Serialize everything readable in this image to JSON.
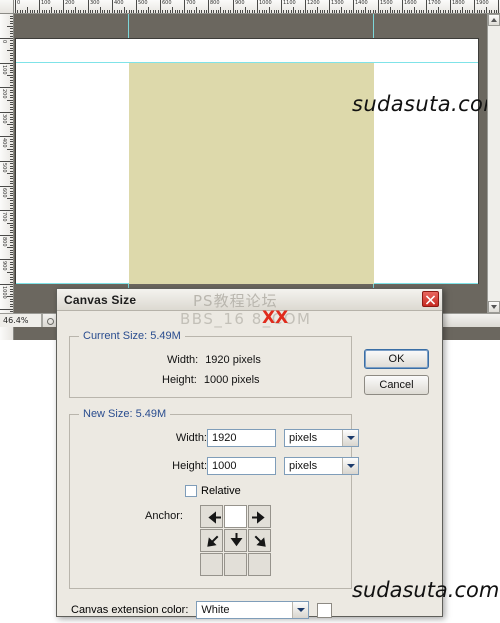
{
  "app": {
    "document_window": {
      "zoom_level": "46.4%",
      "status_text": "",
      "ruler_unit_labels_h": [
        "0",
        "100",
        "200",
        "300",
        "400",
        "500",
        "600",
        "700",
        "800",
        "900",
        "1000",
        "1100",
        "1200",
        "1300",
        "1400",
        "1500",
        "1600",
        "1700",
        "1800",
        "1900"
      ],
      "ruler_unit_labels_v": [
        "0",
        "100",
        "200",
        "300",
        "400",
        "500",
        "600",
        "700",
        "800",
        "900",
        "1000"
      ],
      "canvas_image_color": "#ddd9ab",
      "pasteboard_color": "#6b675f",
      "guide_color": "#7fe3e8"
    },
    "watermarks": {
      "canvas_site": "sudasuta.com",
      "bottom_site": "sudasuta.com",
      "dialog_cn": "PS教程论坛",
      "dialog_bbs": "BBS_16    8_COM",
      "dialog_bbs_highlight": "XX",
      "highlight_color": "#e02b1c"
    }
  },
  "dialog": {
    "title": "Canvas Size",
    "close_label": "×",
    "buttons": {
      "ok": "OK",
      "cancel": "Cancel"
    },
    "current_size": {
      "group_title": "Current Size: 5.49M",
      "rows": [
        {
          "label": "Width:",
          "value": "1920 pixels"
        },
        {
          "label": "Height:",
          "value": "1000 pixels"
        }
      ]
    },
    "new_size": {
      "group_title": "New Size: 5.49M",
      "width": {
        "label": "Width:",
        "value": "1920",
        "unit": "pixels"
      },
      "height": {
        "label": "Height:",
        "value": "1000",
        "unit": "pixels"
      },
      "relative": {
        "label": "Relative",
        "checked": false
      },
      "anchor": {
        "label": "Anchor:",
        "cells": [
          {
            "name": "anchor-top-left",
            "icon": "arrow-left",
            "selected": false
          },
          {
            "name": "anchor-top-center",
            "icon": "none",
            "selected": true
          },
          {
            "name": "anchor-top-right",
            "icon": "arrow-right",
            "selected": false
          },
          {
            "name": "anchor-middle-left",
            "icon": "arrow-down-left",
            "selected": false
          },
          {
            "name": "anchor-middle-center",
            "icon": "arrow-down",
            "selected": false
          },
          {
            "name": "anchor-middle-right",
            "icon": "arrow-down-right",
            "selected": false
          },
          {
            "name": "anchor-bottom-left",
            "icon": "none",
            "selected": false
          },
          {
            "name": "anchor-bottom-center",
            "icon": "none",
            "selected": false
          },
          {
            "name": "anchor-bottom-right",
            "icon": "none",
            "selected": false
          }
        ]
      }
    },
    "extension": {
      "label": "Canvas extension color:",
      "value": "White",
      "swatch_color": "#ffffff"
    }
  }
}
